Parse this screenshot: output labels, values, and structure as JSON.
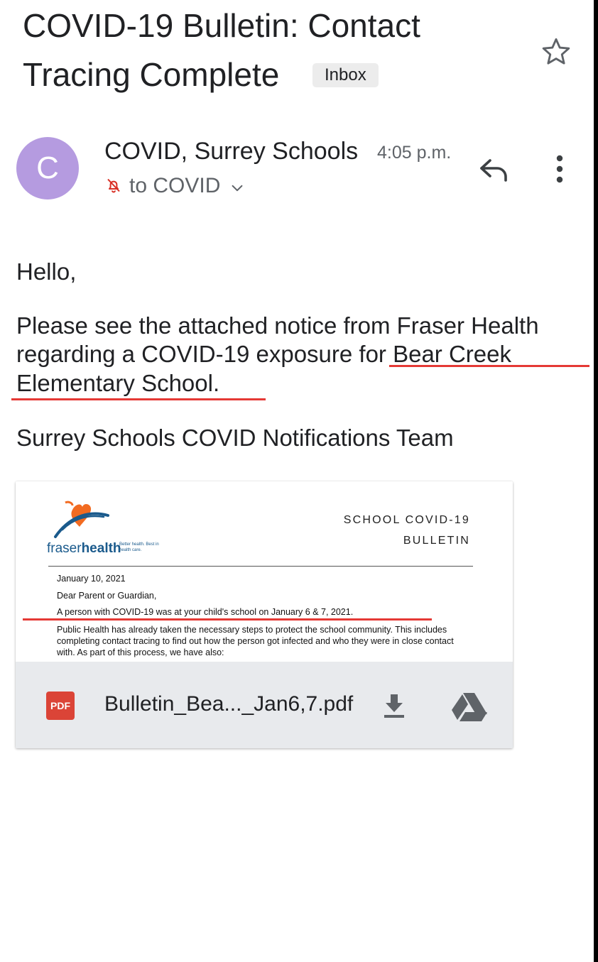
{
  "email": {
    "subject_line1": "COVID-19 Bulletin: Contact",
    "subject_line2": "Tracing Complete",
    "label": "Inbox"
  },
  "sender": {
    "avatar_letter": "C",
    "name": "COVID, Surrey Schools",
    "time": "4:05 p.m.",
    "recipient": "to COVID",
    "avatar_color": "#b59be0"
  },
  "body": {
    "greeting": "Hello,",
    "para_line1": "Please see the attached notice from Fraser Health",
    "para_line2": "regarding a COVID-19 exposure for Bear Creek",
    "para_line3": "Elementary School.",
    "signature": "Surrey Schools COVID Notifications Team"
  },
  "attachment": {
    "preview": {
      "logo_word_light": "fraser",
      "logo_word_bold": "health",
      "logo_tagline": "Better health. Best in health care.",
      "heading_line1": "SCHOOL COVID-19",
      "heading_line2": "BULLETIN",
      "date": "January 10, 2021",
      "salutation": "Dear Parent or Guardian,",
      "exposure": "A person with COVID-19 was at your child's school on January 6 & 7, 2021.",
      "paragraph_line1": "Public Health has already taken the necessary steps to protect the school community. This includes",
      "paragraph_line2": "completing contact tracing to find out how the person got infected and who they were in close contact",
      "paragraph_line3": "with. As part of this process, we have also:"
    },
    "type_badge": "PDF",
    "file_name": "Bulletin_Bea..._Jan6,7.pdf"
  },
  "icons": {
    "star": "star-icon",
    "notification": "bell-off-icon",
    "chevron": "chevron-down-icon",
    "reply": "reply-icon",
    "more": "more-vert-icon",
    "download": "download-icon",
    "drive": "drive-icon"
  },
  "colors": {
    "highlight_underline": "#e53935",
    "pdf_badge": "#db4437",
    "fraser_health_blue": "#1a5a8c",
    "fraser_health_orange": "#f26b21"
  }
}
